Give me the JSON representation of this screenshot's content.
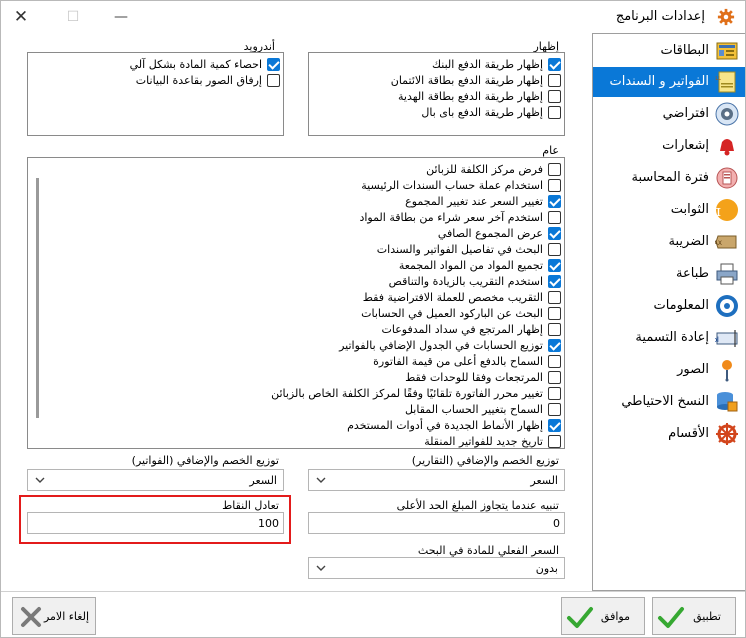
{
  "window": {
    "title": "إعدادات البرنامج",
    "icons": {
      "app": "gear-icon",
      "close": "close-icon",
      "maximize": "maximize-icon",
      "minimize": "minimize-icon"
    }
  },
  "nav": {
    "items": [
      {
        "label": "البطاقات",
        "icon": "cards-icon",
        "selected": false
      },
      {
        "label": "الفواتير و السندات",
        "icon": "invoice-icon",
        "selected": true
      },
      {
        "label": "افتراضي",
        "icon": "default-gear-icon",
        "selected": false
      },
      {
        "label": "إشعارات",
        "icon": "bell-icon",
        "selected": false
      },
      {
        "label": "فترة المحاسبة",
        "icon": "accounting-period-icon",
        "selected": false
      },
      {
        "label": "الثوابت",
        "icon": "pi-icon",
        "selected": false
      },
      {
        "label": "الضريبة",
        "icon": "tax-icon",
        "selected": false
      },
      {
        "label": "طباعة",
        "icon": "printer-icon",
        "selected": false
      },
      {
        "label": "المعلومات",
        "icon": "info-icon",
        "selected": false
      },
      {
        "label": "إعادة التسمية",
        "icon": "rename-icon",
        "selected": false
      },
      {
        "label": "الصور",
        "icon": "images-icon",
        "selected": false
      },
      {
        "label": "النسخ الاحتياطي",
        "icon": "backup-icon",
        "selected": false
      },
      {
        "label": "الأقسام",
        "icon": "sections-icon",
        "selected": false
      }
    ]
  },
  "display_group": {
    "label": "إظهار",
    "items": [
      {
        "label": "إظهار طريقة الدفع البنك",
        "checked": true
      },
      {
        "label": "إظهار طريقة الدفع بطاقة الائتمان",
        "checked": false
      },
      {
        "label": "إظهار طريقة الدفع بطاقة الهدية",
        "checked": false
      },
      {
        "label": "إظهار طريقة الدفع باى بال",
        "checked": false
      }
    ]
  },
  "android_group": {
    "label": "أندرويد",
    "items": [
      {
        "label": "احصاء كمية المادة بشكل آلي",
        "checked": true
      },
      {
        "label": "إرفاق الصور بقاعدة البيانات",
        "checked": false
      }
    ]
  },
  "general_group": {
    "label": "عام",
    "items": [
      {
        "label": "فرض مركز الكلفة للزبائن",
        "checked": false
      },
      {
        "label": "استخدام عملة حساب السندات الرئيسية",
        "checked": false
      },
      {
        "label": "تغيير السعر عند تغيير المجموع",
        "checked": true
      },
      {
        "label": "استخدم آخر سعر شراء من بطاقة المواد",
        "checked": false
      },
      {
        "label": "عرض المجموع الصافي",
        "checked": true
      },
      {
        "label": "البحث في تفاصيل الفواتير والسندات",
        "checked": false
      },
      {
        "label": "تجميع المواد من المواد المجمعة",
        "checked": true
      },
      {
        "label": "استخدم التقريب بالزيادة والتناقص",
        "checked": true
      },
      {
        "label": "التقريب مخصص للعملة الافتراضية فقط",
        "checked": false
      },
      {
        "label": "البحث عن الباركود العميل في الحسابات",
        "checked": false
      },
      {
        "label": "إظهار المرتجع في سداد المدفوعات",
        "checked": false
      },
      {
        "label": "توزيع الحسابات في الجدول الإضافي بالفواتير",
        "checked": true
      },
      {
        "label": "السماح بالدفع أعلى من قيمة الفاتورة",
        "checked": false
      },
      {
        "label": "المرتجعات وفقا للوحدات فقط",
        "checked": false
      },
      {
        "label": "تغيير محرر الفاتورة تلقائيًا وفقًا لمركز الكلفة الخاص بالزبائن",
        "checked": false
      },
      {
        "label": "السماح بتغيير الحساب المقابل",
        "checked": false
      },
      {
        "label": "إظهار الأنماط الجديدة في أدوات المستخدم",
        "checked": true
      },
      {
        "label": "تاريخ جديد للفواتير المنقلة",
        "checked": false
      }
    ]
  },
  "fields": {
    "discount_reports": {
      "label": "توزيع الخصم والإضافي (التقارير)",
      "value": "السعر"
    },
    "discount_invoices": {
      "label": "توزيع الخصم والإضافي (الفواتير)",
      "value": "السعر"
    },
    "max_amount_alert": {
      "label": "تنبيه عندما يتجاوز المبلغ الحد الأعلى",
      "value": "0"
    },
    "points_equivalent": {
      "label": "تعادل النقاط",
      "value": "100"
    },
    "actual_price_search": {
      "label": "السعر الفعلي للمادة في البحث",
      "value": "بدون"
    }
  },
  "buttons": {
    "apply": {
      "label": "تطبيق",
      "icon": "check-icon"
    },
    "ok": {
      "label": "موافق",
      "icon": "check-icon"
    },
    "cancel": {
      "label": "إلغاء الامر",
      "icon": "close-icon"
    }
  },
  "colors": {
    "accent": "#0a78d7",
    "highlight": "#e31b1b"
  }
}
